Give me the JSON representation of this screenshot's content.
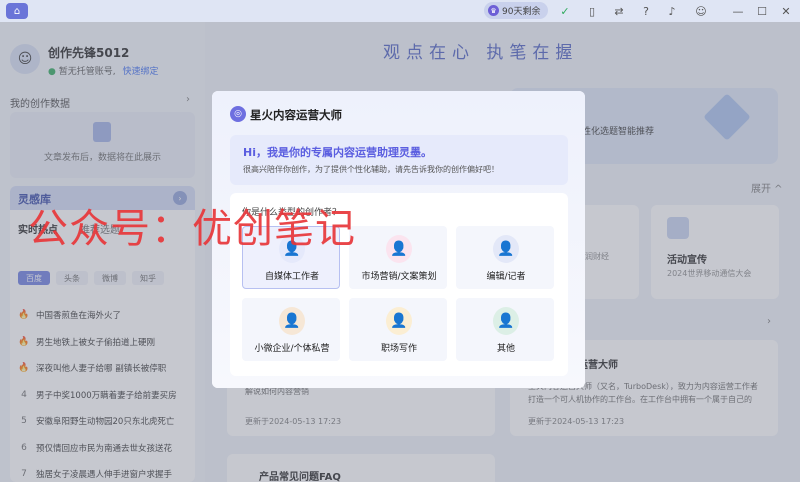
{
  "titlebar": {
    "quota": "90天剩余"
  },
  "sidebar": {
    "username": "创作先锋5012",
    "account_status": "暂无托管账号,",
    "bind_link": "快速绑定",
    "my_data_title": "我的创作数据",
    "my_data_empty": "文章发布后，数据将在此展示",
    "inspiration": {
      "title": "灵感库",
      "tabs": [
        "实时热点",
        "推荐选题"
      ],
      "chips": [
        "百度",
        "头条",
        "微博",
        "知乎"
      ],
      "hot_items": [
        {
          "rank": "🔥",
          "text": "中国香煎鱼在海外火了"
        },
        {
          "rank": "🔥",
          "text": "男生地铁上被女子偷拍道上硬刚"
        },
        {
          "rank": "🔥",
          "text": "深夜叫他人妻子给哪 副镇长被停职"
        },
        {
          "rank": "4",
          "text": "男子中奖1000万瞒着妻子给前妻买房"
        },
        {
          "rank": "5",
          "text": "安徽阜阳野生动物园20只东北虎死亡"
        },
        {
          "rank": "6",
          "text": "预仅情回应市民为南通去世女孩送花"
        },
        {
          "rank": "7",
          "text": "独居女子凌晨遇人伸手进窗户求握手"
        }
      ]
    }
  },
  "main": {
    "slogan": "观点在心 执笔在握",
    "banner_text": "性化选题智能推荐",
    "expand": "展开 ^",
    "cards": [
      {
        "title": "活动宣传",
        "sub": "2024世界移动通信大会"
      }
    ],
    "card_left_sub": "润财经",
    "news": {
      "title": "续星火内容运营大师",
      "body": "星火内容运营大师（又名，TurboDesk），致力为内容运营工作者打造一个可人机协作的工作台。在工作台中拥有一个属于自己的",
      "date": "更新于2024-05-13 17:23"
    },
    "news_left_date": "更新于2024-05-13 17:23",
    "news_left_text": "解说如何内容营销",
    "faq_title": "产品常见问题FAQ"
  },
  "modal": {
    "title": "星火内容运营大师",
    "greeting": "Hi，我是你的专属内容运营助理灵墨。",
    "greeting_sub": "很高兴陪伴你创作，为了提供个性化辅助，请先告诉我你的创作偏好吧！",
    "question": "你是什么类型的创作者？",
    "roles": [
      {
        "label": "自媒体工作者",
        "selected": true
      },
      {
        "label": "市场营销/文案策划",
        "selected": false
      },
      {
        "label": "编辑/记者",
        "selected": false
      },
      {
        "label": "小微企业/个体私营",
        "selected": false
      },
      {
        "label": "职场写作",
        "selected": false
      },
      {
        "label": "其他",
        "selected": false
      }
    ]
  },
  "watermark": "公众号：优创笔记",
  "colors": {
    "accent": "#5b5ee0",
    "watermark": "#e8373a",
    "selected_border": "#b7c0f1"
  }
}
